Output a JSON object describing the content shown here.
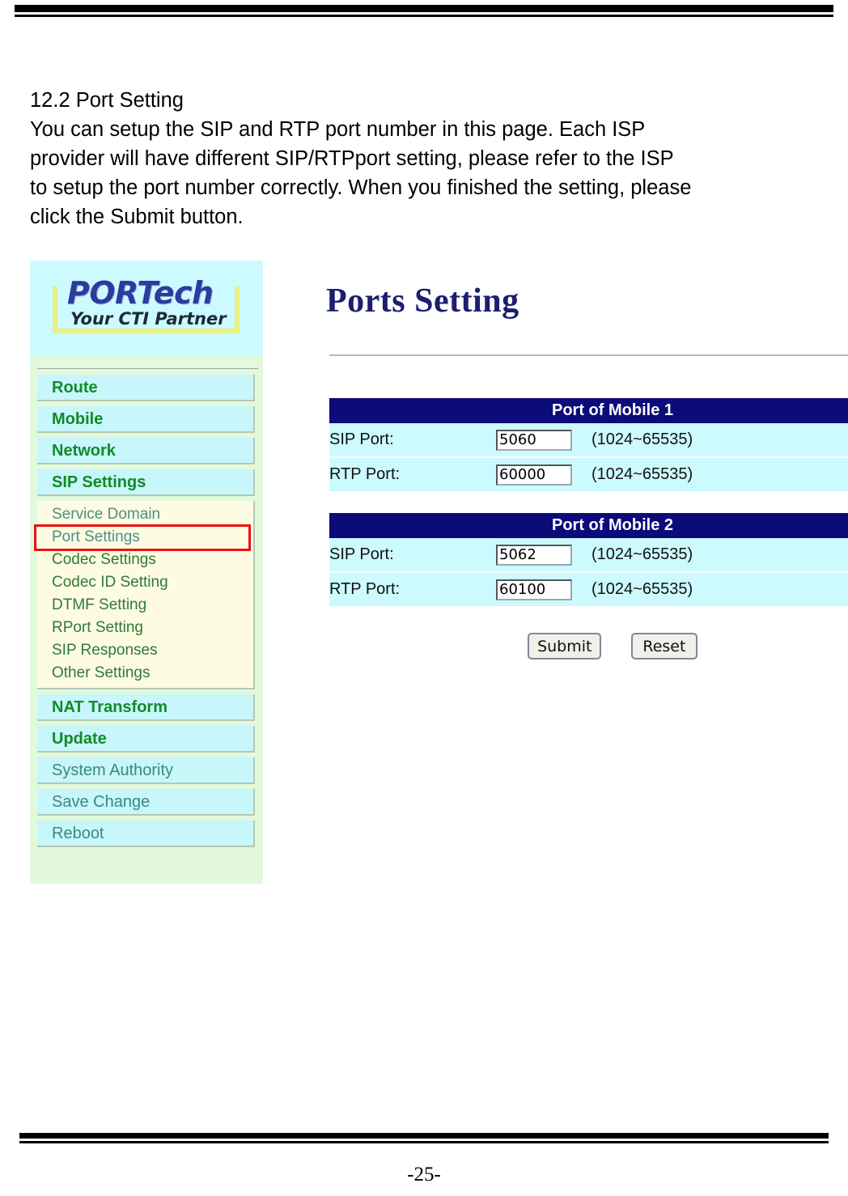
{
  "document": {
    "page_number": "-25-",
    "section_heading": "12.2 Port Setting",
    "body_lines": [
      "You can setup the SIP and RTP port number in this page. Each ISP",
      "provider will have different SIP/RTPport setting, please refer to the ISP",
      "to setup the port number correctly. When you finished the setting, please",
      "click the Submit button."
    ]
  },
  "colors": {
    "header_navy": "#0b0b7a",
    "title_navy": "#1d1d72",
    "row_cyan": "#ccfaff",
    "sidebar_green": "#e2f9dd",
    "submenu_cream": "#fdfbe2",
    "highlight_red": "#ee1111",
    "nav_label_green": "#128a28"
  },
  "sidebar": {
    "logo": {
      "brand": "PORTech",
      "tagline": "Your CTI Partner"
    },
    "nav_items": [
      {
        "label": "Route",
        "bold": true
      },
      {
        "label": "Mobile",
        "bold": true
      },
      {
        "label": "Network",
        "bold": true
      },
      {
        "label": "SIP Settings",
        "bold": true
      }
    ],
    "sub_items": [
      {
        "label": "Service Domain",
        "selected": false
      },
      {
        "label": "Port Settings",
        "selected": true
      },
      {
        "label": "Codec Settings",
        "selected": false
      },
      {
        "label": "Codec ID Setting",
        "selected": false
      },
      {
        "label": "DTMF Setting",
        "selected": false
      },
      {
        "label": "RPort Setting",
        "selected": false
      },
      {
        "label": "SIP Responses",
        "selected": false
      },
      {
        "label": "Other Settings",
        "selected": false
      }
    ],
    "nav_items_lower": [
      {
        "label": "NAT Transform",
        "bold": true
      },
      {
        "label": "Update",
        "bold": true
      },
      {
        "label": "System Authority",
        "bold": false
      },
      {
        "label": "Save Change",
        "bold": false
      },
      {
        "label": "Reboot",
        "bold": false
      }
    ]
  },
  "main": {
    "title": "Ports Setting",
    "tables": [
      {
        "header": "Port of Mobile 1",
        "rows": [
          {
            "label": "SIP Port:",
            "value": "5060",
            "hint": "(1024~65535)"
          },
          {
            "label": "RTP Port:",
            "value": "60000",
            "hint": "(1024~65535)"
          }
        ]
      },
      {
        "header": "Port of Mobile 2",
        "rows": [
          {
            "label": "SIP Port:",
            "value": "5062",
            "hint": "(1024~65535)"
          },
          {
            "label": "RTP Port:",
            "value": "60100",
            "hint": "(1024~65535)"
          }
        ]
      }
    ],
    "buttons": {
      "submit": "Submit",
      "reset": "Reset"
    }
  }
}
